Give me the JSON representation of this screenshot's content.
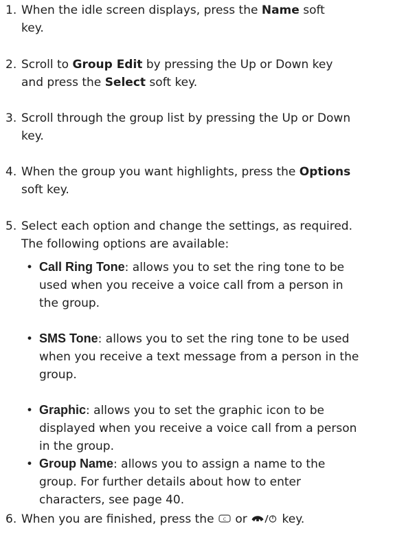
{
  "steps": [
    {
      "num": "1.",
      "lines": [
        [
          "When the idle screen displays, press the ",
          {
            "b": "Name"
          },
          " soft"
        ],
        [
          "key."
        ]
      ]
    },
    {
      "num": "2.",
      "lines": [
        [
          "Scroll to ",
          {
            "b": "Group Edit"
          },
          " by pressing the Up or Down key"
        ],
        [
          "and press the ",
          {
            "b": "Select"
          },
          " soft key."
        ]
      ]
    },
    {
      "num": "3.",
      "lines": [
        [
          "Scroll through the group list by pressing the Up or Down"
        ],
        [
          "key."
        ]
      ]
    },
    {
      "num": "4.",
      "lines": [
        [
          "When the group you want highlights, press the ",
          {
            "b": "Options"
          }
        ],
        [
          "soft key."
        ]
      ]
    },
    {
      "num": "5.",
      "lines": [
        [
          "Select each option and change the settings, as required."
        ],
        [
          "The following options are available:"
        ]
      ]
    },
    {
      "num": "6.",
      "lines": [
        [
          "When you are finished, press the ",
          {
            "icon": "clear-key-icon"
          },
          " or ",
          {
            "icon": "end-power-key-icon"
          },
          " key."
        ]
      ]
    }
  ],
  "options": [
    {
      "term": "Call Ring Tone",
      "lines": [
        ": allows you to set the ring tone to be",
        "used when you receive a voice call from a person in",
        "the group."
      ]
    },
    {
      "term": "SMS Tone",
      "lines": [
        ": allows you to set the ring tone to be used",
        "when you receive a text message from a person in the",
        "group."
      ]
    },
    {
      "term": "Graphic",
      "lines": [
        ": allows you to set the graphic icon to be",
        "displayed when you receive a voice call from a person",
        "in the group."
      ]
    },
    {
      "term": "Group Name",
      "lines": [
        ": allows you to assign a name to the",
        "group. For further details about how to enter",
        "characters, see page 40."
      ]
    }
  ]
}
